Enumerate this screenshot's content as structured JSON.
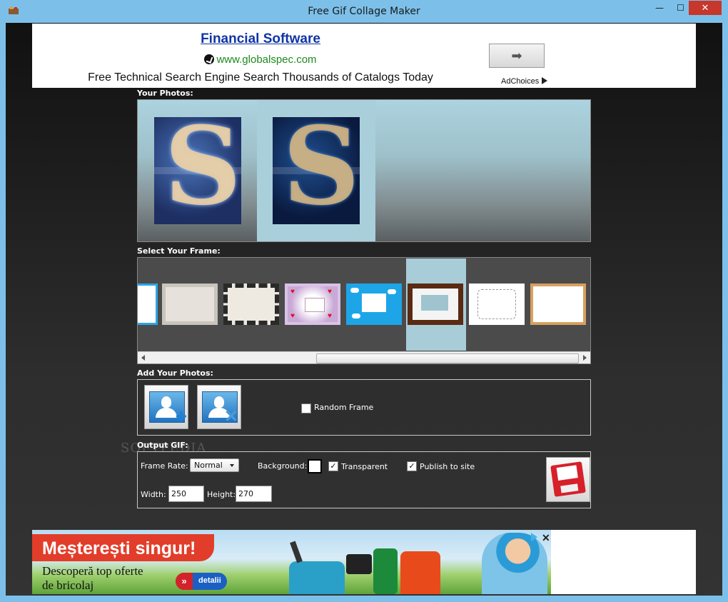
{
  "window": {
    "title": "Free Gif Collage Maker",
    "minimize_glyph": "—",
    "maximize_glyph": "☐",
    "close_glyph": "✕",
    "frame_color": "#7cc0ea",
    "close_color": "#c7372b"
  },
  "ad_top": {
    "headline": "Financial Software",
    "url": "www.globalspec.com",
    "description": "Free Technical Search Engine Search Thousands of Catalogs Today",
    "arrow_glyph": "➡",
    "adchoices": "AdChoices"
  },
  "photos": {
    "label": "Your Photos:",
    "items": [
      {
        "name": "photo-1",
        "selected": false,
        "glyph": "S"
      },
      {
        "name": "photo-2",
        "selected": true,
        "glyph": "S"
      }
    ]
  },
  "frames": {
    "label": "Select Your Frame:",
    "selected_index": 5,
    "count": 8
  },
  "add_photos": {
    "label": "Add Your Photos:",
    "random_frame_label": "Random Frame",
    "random_frame_checked": false
  },
  "watermark": "SOFTPEDIA",
  "output": {
    "label": "Output GIF:",
    "frame_rate_label": "Frame Rate:",
    "frame_rate_value": "Normal",
    "background_label": "Background:",
    "background_color": "#ffffff",
    "transparent_label": "Transparent",
    "transparent_checked": true,
    "publish_label": "Publish to site",
    "publish_checked": true,
    "width_label": "Width:",
    "width_value": "250",
    "height_label": "Height:",
    "height_value": "270",
    "check_glyph": "✓"
  },
  "ad_bottom": {
    "title": "Meșterești singur!",
    "line1": "Descoperă top oferte",
    "line2": "de bricolaj",
    "cta_arrow": "»",
    "cta": "detalii",
    "close_glyph": "✕"
  }
}
